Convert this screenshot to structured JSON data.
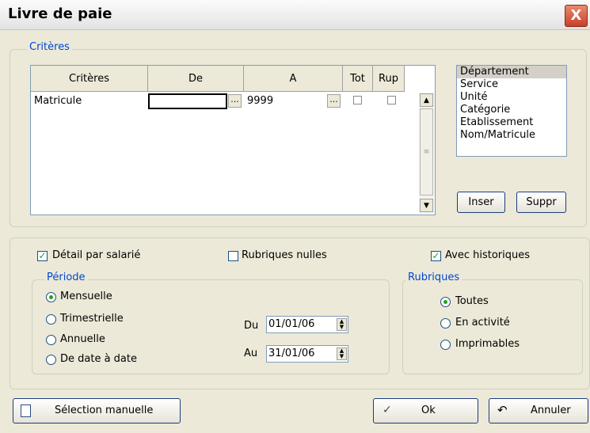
{
  "window": {
    "title": "Livre de paie",
    "close_glyph": "X"
  },
  "criteres_group": {
    "legend": "Critères",
    "columns": [
      "Critères",
      "De",
      "A",
      "Tot",
      "Rup"
    ],
    "row": {
      "critere": "Matricule",
      "de": "",
      "a": "9999",
      "ellipsis": "..."
    }
  },
  "list": {
    "items": [
      "Département",
      "Service",
      "Unité",
      "Catégorie",
      "Etablissement",
      "Nom/Matricule"
    ],
    "selected_index": 0
  },
  "buttons": {
    "inser": "Inser",
    "suppr": "Suppr",
    "selection": "Sélection manuelle",
    "ok": "Ok",
    "annuler": "Annuler"
  },
  "options": {
    "detail": "Détail par salarié",
    "rubriques_nulles": "Rubriques nulles",
    "avec_historiques": "Avec historiques"
  },
  "periode": {
    "legend": "Période",
    "items": [
      "Mensuelle",
      "Trimestrielle",
      "Annuelle",
      "De date à date"
    ],
    "du_label": "Du",
    "du_value": "01/01/06",
    "au_label": "Au",
    "au_value": "31/01/06"
  },
  "rubriques": {
    "legend": "Rubriques",
    "items": [
      "Toutes",
      "En activité",
      "Imprimables"
    ]
  },
  "colors": {
    "accent": "#0046d5",
    "check": "#21a121"
  }
}
